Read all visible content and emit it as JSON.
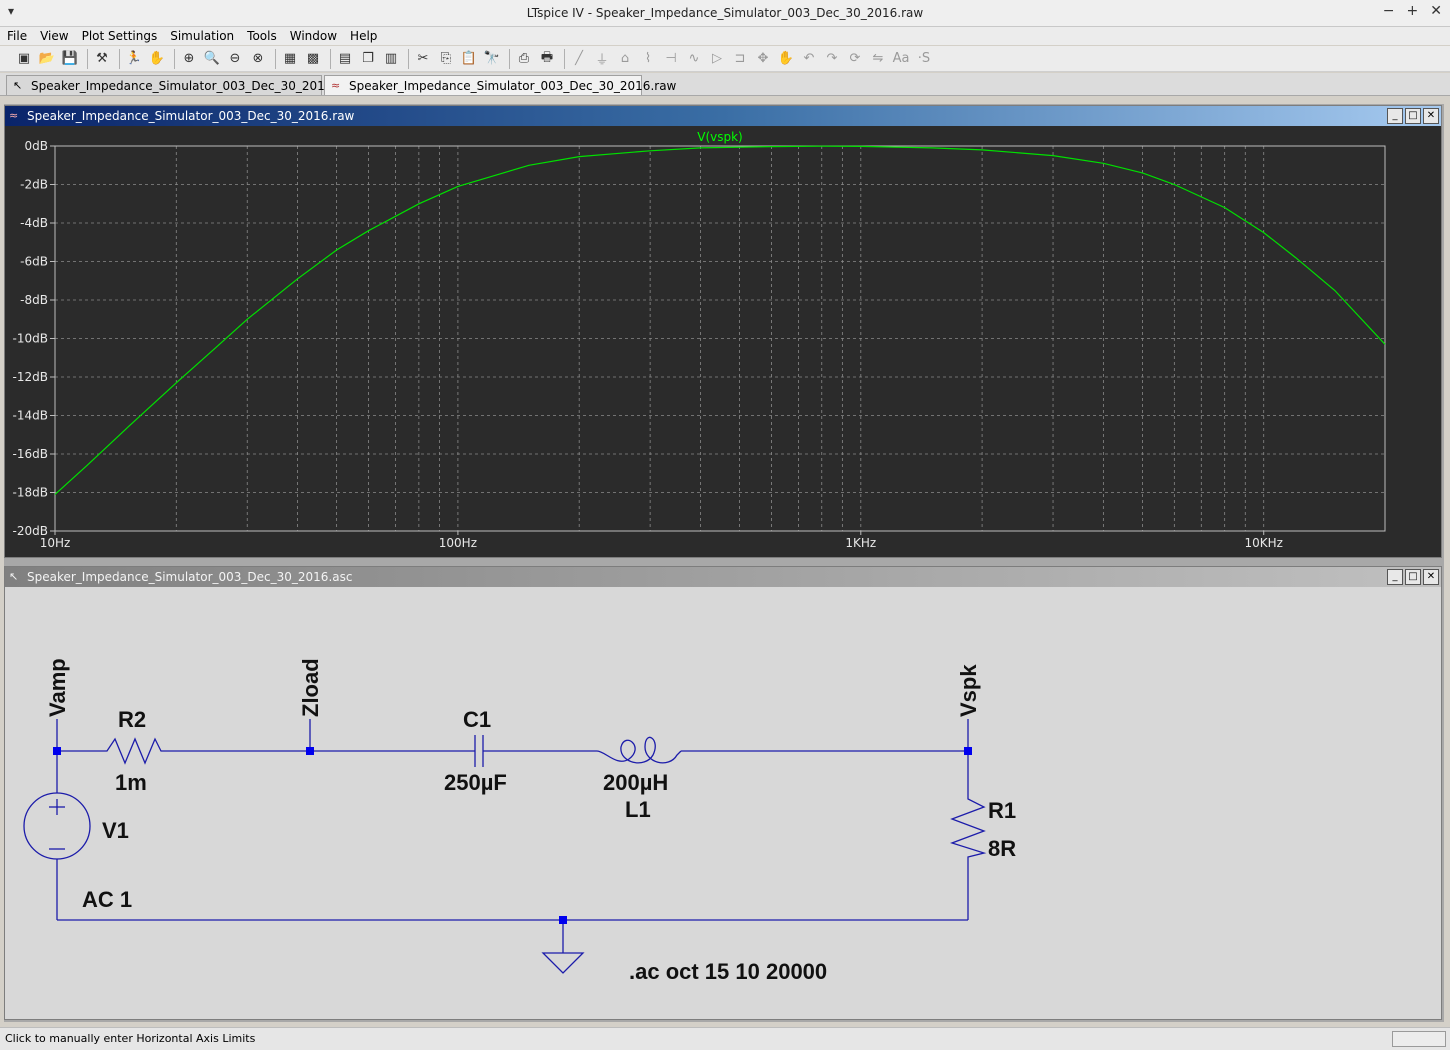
{
  "app": {
    "title": "LTspice IV - Speaker_Impedance_Simulator_003_Dec_30_2016.raw",
    "window_menu": "▾",
    "window_buttons": [
      "−",
      "+",
      "✕"
    ]
  },
  "menu": [
    "File",
    "View",
    "Plot Settings",
    "Simulation",
    "Tools",
    "Window",
    "Help"
  ],
  "tabs": [
    {
      "label": "Speaker_Impedance_Simulator_003_Dec_30_2016.asc",
      "icon": "schematic-icon"
    },
    {
      "label": "Speaker_Impedance_Simulator_003_Dec_30_2016.raw",
      "icon": "waveform-icon"
    }
  ],
  "plot_window": {
    "title": "Speaker_Impedance_Simulator_003_Dec_30_2016.raw",
    "controls": [
      "_",
      "□",
      "✕"
    ]
  },
  "schematic_window": {
    "title": "Speaker_Impedance_Simulator_003_Dec_30_2016.asc",
    "controls": [
      "_",
      "□",
      "✕"
    ]
  },
  "chart_data": {
    "type": "line",
    "title": "",
    "xscale": "log",
    "xlim": [
      10,
      20000
    ],
    "ylim": [
      -20,
      0
    ],
    "x_tick_labels": [
      "10Hz",
      "100Hz",
      "1KHz",
      "10KHz"
    ],
    "x_tick_values": [
      10,
      100,
      1000,
      10000
    ],
    "y_tick_labels": [
      "0dB",
      "-2dB",
      "-4dB",
      "-6dB",
      "-8dB",
      "-10dB",
      "-12dB",
      "-14dB",
      "-16dB",
      "-18dB",
      "-20dB"
    ],
    "y_tick_values": [
      0,
      -2,
      -4,
      -6,
      -8,
      -10,
      -12,
      -14,
      -16,
      -18,
      -20
    ],
    "grid": true,
    "background": "#2b2b2b",
    "grid_color": "#8a8a8a",
    "series": [
      {
        "name": "V(vspk)",
        "color": "#00e000",
        "x": [
          10,
          12,
          15,
          20,
          25,
          30,
          40,
          50,
          60,
          80,
          100,
          150,
          200,
          300,
          400,
          600,
          800,
          1000,
          1500,
          2000,
          3000,
          4000,
          5000,
          6000,
          8000,
          10000,
          12000,
          15000,
          20000
        ],
        "y": [
          -18.1,
          -16.6,
          -14.7,
          -12.3,
          -10.5,
          -9.0,
          -6.9,
          -5.4,
          -4.4,
          -3.0,
          -2.1,
          -1.0,
          -0.55,
          -0.25,
          -0.1,
          -0.03,
          -0.01,
          -0.02,
          -0.1,
          -0.2,
          -0.5,
          -0.9,
          -1.4,
          -2.0,
          -3.2,
          -4.5,
          -5.8,
          -7.5,
          -10.3
        ]
      }
    ]
  },
  "schematic": {
    "labels": {
      "vamp": "Vamp",
      "zload": "Zload",
      "vspk": "Vspk",
      "r2_name": "R2",
      "r2_value": "1m",
      "c1_name": "C1",
      "c1_value": "250µF",
      "l1_value": "200µH",
      "l1_name": "L1",
      "r1_name": "R1",
      "r1_value": "8R",
      "v1_name": "V1",
      "v1_value": "AC 1",
      "directive": ".ac oct 15 10 20000"
    },
    "wire_color": "#1c1caa",
    "node_color": "#0000ee"
  },
  "toolbar": {
    "icons": [
      "new-schematic-icon",
      "open-icon",
      "save-icon",
      "sep",
      "control-panel-icon",
      "sep",
      "run-icon",
      "halt-icon",
      "sep",
      "zoom-in-icon",
      "zoom-pan-icon",
      "zoom-out-icon",
      "zoom-fit-icon",
      "sep",
      "autorange-icon",
      "grid-icon",
      "sep",
      "tile-horizontal-icon",
      "cascade-icon",
      "tile-vertical-icon",
      "sep",
      "cut-icon",
      "copy-icon",
      "paste-icon",
      "find-icon",
      "sep",
      "print-icon",
      "print-preview-icon",
      "sep",
      "wire-icon",
      "ground-icon",
      "label-net-icon",
      "resistor-icon",
      "capacitor-icon",
      "inductor-icon",
      "diode-icon",
      "component-icon",
      "move-icon",
      "drag-icon",
      "undo-icon",
      "redo-icon",
      "rotate-icon",
      "mirror-icon",
      "text-icon",
      "spice-directive-icon"
    ],
    "glyphs": [
      "▣",
      "📂",
      "💾",
      "|",
      "⚒",
      "|",
      "🏃",
      "✋",
      "|",
      "⊕",
      "🔍",
      "⊖",
      "⊗",
      "|",
      "▦",
      "▩",
      "|",
      "▤",
      "❐",
      "▥",
      "|",
      "✂",
      "⎘",
      "📋",
      "🔭",
      "|",
      "⎙",
      "🖶",
      "|",
      "╱",
      "⏚",
      "⌂",
      "⌇",
      "⊣",
      "∿",
      "▷",
      "⊐",
      "✥",
      "✋",
      "↶",
      "↷",
      "⟳",
      "⇋",
      "Aa",
      "·S"
    ]
  },
  "status": {
    "message": "Click to manually enter Horizontal Axis Limits"
  }
}
